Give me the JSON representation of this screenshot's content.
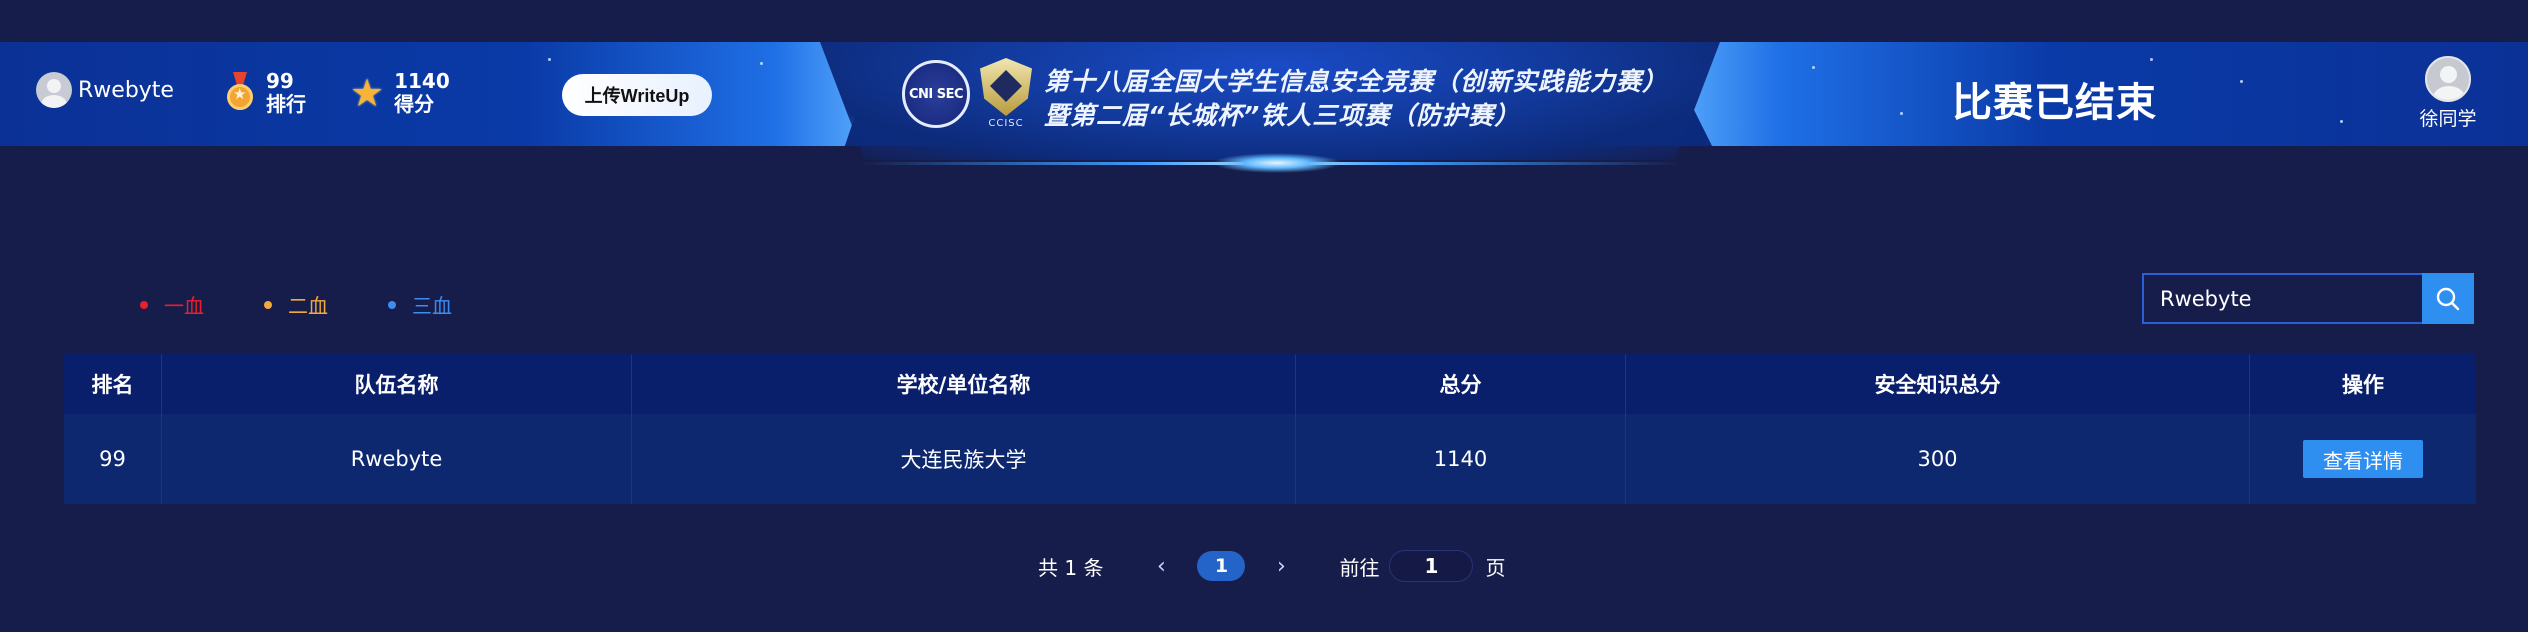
{
  "header": {
    "user_name": "Rwebyte",
    "rank_value": "99",
    "rank_label": "排行",
    "score_value": "1140",
    "score_label": "得分",
    "upload_label": "上传WriteUp",
    "logo_left_text": "CNI SEC",
    "logo_right_caption": "CCISC",
    "title_line1": "第十八届全国大学生信息安全竞赛（创新实践能力赛）",
    "title_line2": "暨第二届“长城杯”铁人三项赛（防护赛）",
    "status": "比赛已结束",
    "right_user_name": "徐同学"
  },
  "legend": [
    {
      "label": "一血",
      "color": "#e8202a"
    },
    {
      "label": "二血",
      "color": "#f3a93b"
    },
    {
      "label": "三血",
      "color": "#3d8cf0"
    }
  ],
  "search": {
    "value": "Rwebyte"
  },
  "table": {
    "headers": [
      "排名",
      "队伍名称",
      "学校/单位名称",
      "总分",
      "安全知识总分",
      "操作"
    ],
    "rows": [
      {
        "rank": "99",
        "team": "Rwebyte",
        "school": "大连民族大学",
        "total": "1140",
        "knowledge": "300",
        "action": "查看详情"
      }
    ]
  },
  "pagination": {
    "total_text": "共 1 条",
    "current_page": "1",
    "goto_label": "前往",
    "goto_value": "1",
    "page_suffix": "页"
  },
  "colors": {
    "background": "#171d4a",
    "accent": "#2f8ff1",
    "table_header": "#0a1f6c",
    "table_row": "#0e2870"
  }
}
